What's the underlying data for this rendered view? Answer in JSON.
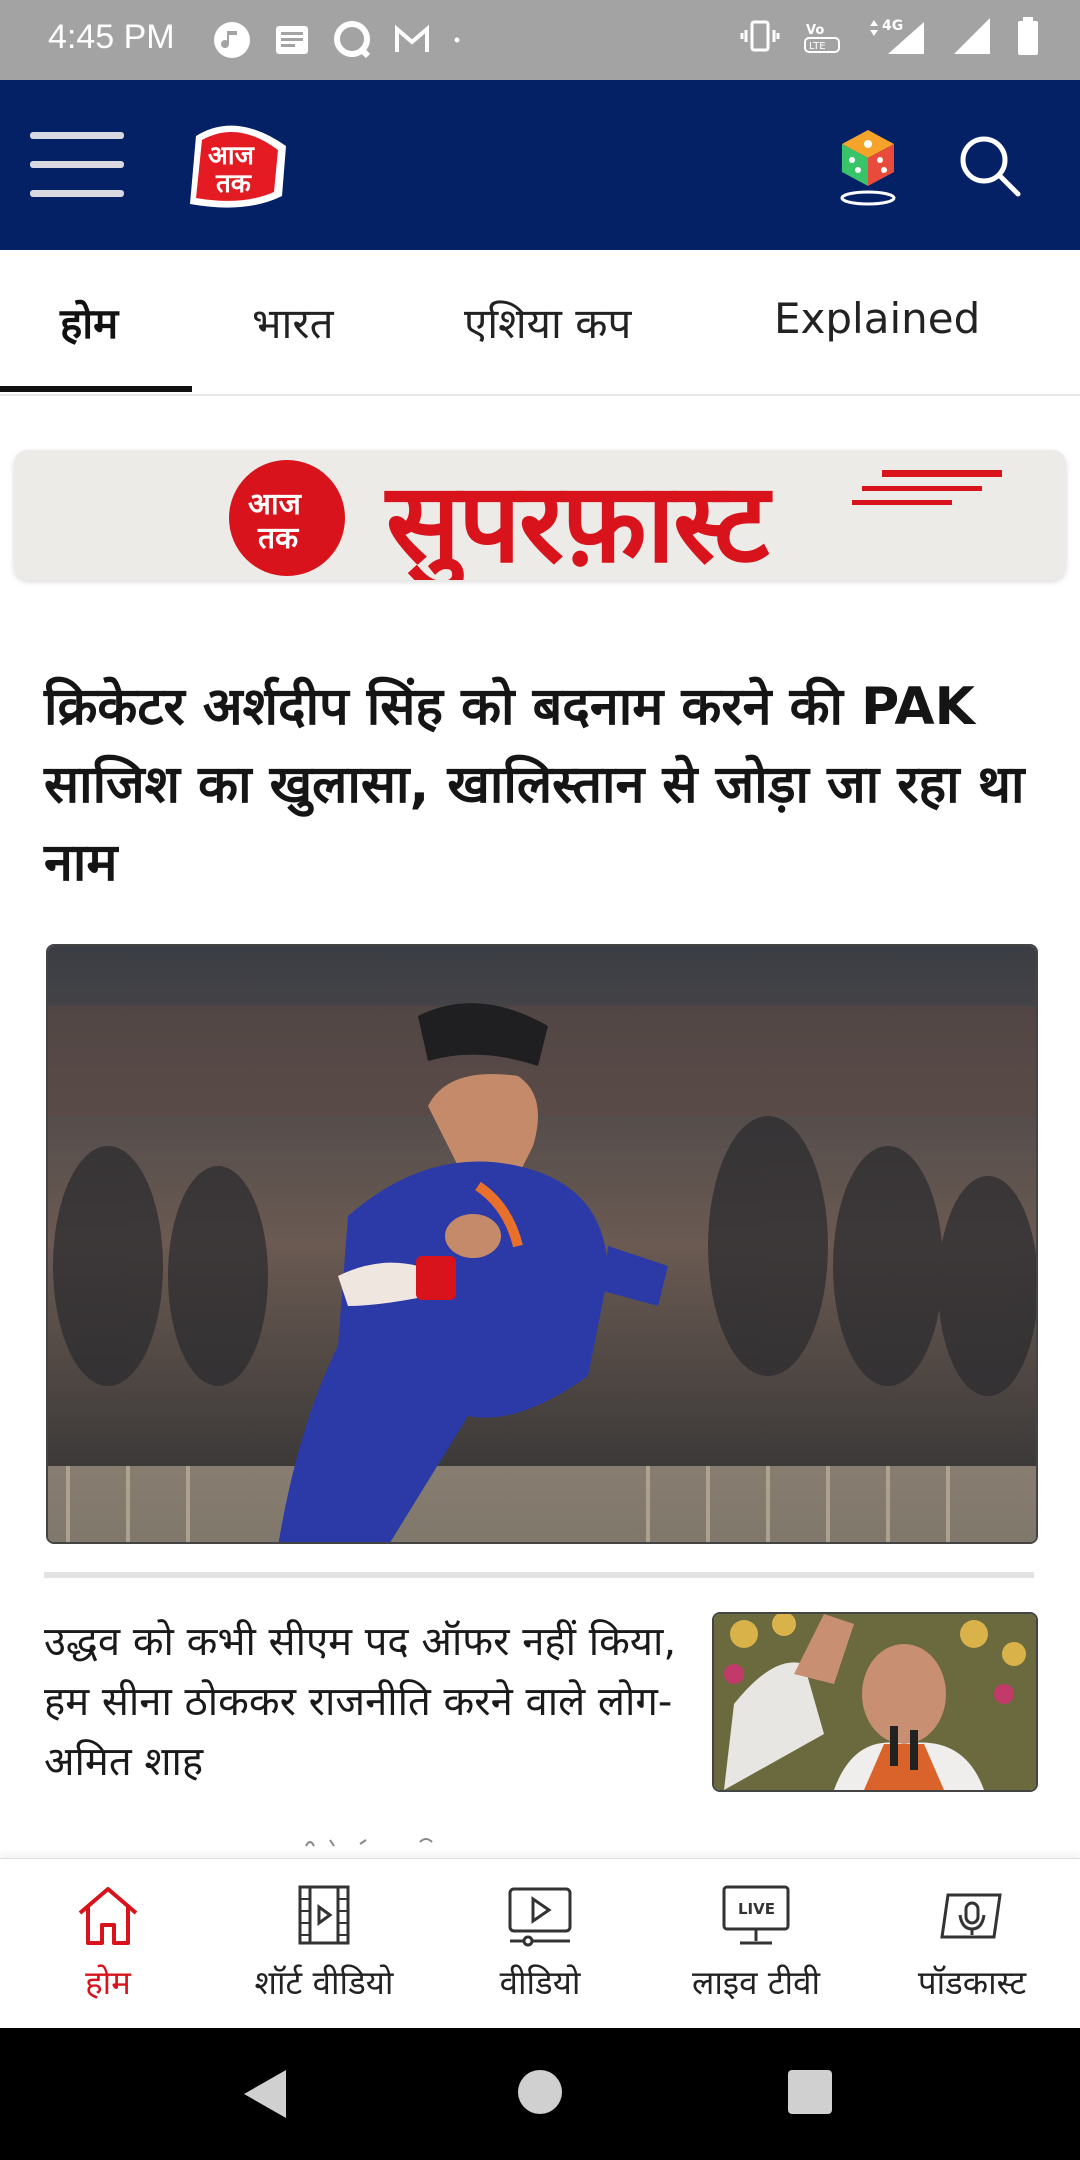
{
  "status_bar": {
    "time": "4:45 PM",
    "network": "4G",
    "volte": "VoLTE"
  },
  "header": {
    "logo_text": "आज तक",
    "icons": [
      "menu-icon",
      "dice-icon",
      "search-icon"
    ]
  },
  "tabs": [
    {
      "label": "होम",
      "active": true
    },
    {
      "label": "भारत",
      "active": false
    },
    {
      "label": "एशिया कप",
      "active": false
    },
    {
      "label": "Explained",
      "active": false
    }
  ],
  "banner": {
    "logo_text": "आज तक",
    "title": "सुपरफ़ास्ट",
    "accent_color": "#d8131b"
  },
  "main": {
    "headline": "क्रिकेटर अर्शदीप सिंह को बदनाम करने की PAK साजिश का खुलासा, खालिस्तान से जोड़ा जा रहा था नाम",
    "story": "उद्धव को कभी सीएम पद ऑफर नहीं किया, हम सीना ठोककर राजनीति करने वाले लोग- अमित शाह"
  },
  "bottom_nav": [
    {
      "label": "होम",
      "icon": "home-icon",
      "active": true
    },
    {
      "label": "शॉर्ट वीडियो",
      "icon": "film-icon",
      "active": false
    },
    {
      "label": "वीडियो",
      "icon": "video-play-icon",
      "active": false
    },
    {
      "label": "लाइव टीवी",
      "icon": "live-tv-icon",
      "active": false,
      "badge": "LIVE"
    },
    {
      "label": "पॉडकास्ट",
      "icon": "podcast-icon",
      "active": false
    }
  ],
  "colors": {
    "header_bg": "#052166",
    "accent": "#d8131b",
    "status_bar_bg": "#a3a3a3"
  }
}
